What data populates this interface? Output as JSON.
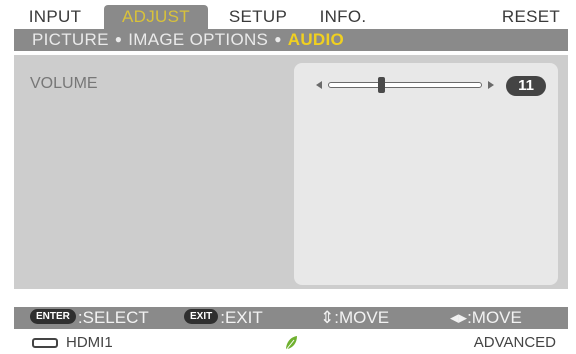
{
  "tabs": [
    {
      "label": "INPUT",
      "active": false
    },
    {
      "label": "ADJUST",
      "active": true
    },
    {
      "label": "SETUP",
      "active": false
    },
    {
      "label": "INFO.",
      "active": false
    },
    {
      "label": "RESET",
      "active": false
    }
  ],
  "submenu": {
    "items": [
      "PICTURE",
      "IMAGE OPTIONS",
      "AUDIO"
    ],
    "current": "AUDIO",
    "separator": "●"
  },
  "panel": {
    "volume_label": "VOLUME",
    "volume_value": "11",
    "volume_fraction": 0.34
  },
  "help": {
    "enter_key": "ENTER",
    "enter_action": ":SELECT",
    "exit_key": "EXIT",
    "exit_action": ":EXIT",
    "move_ud": "⇕:MOVE",
    "move_lr": "◂▸:MOVE"
  },
  "status": {
    "source": "HDMI1",
    "mode": "ADVANCED",
    "eco_icon": "leaf-icon",
    "source_icon": "hdmi-connector-icon"
  },
  "colors": {
    "accent": "#d9c23a",
    "bar": "#8a8a8a",
    "panel": "#cdcdcd",
    "eco": "#6fb12f"
  }
}
